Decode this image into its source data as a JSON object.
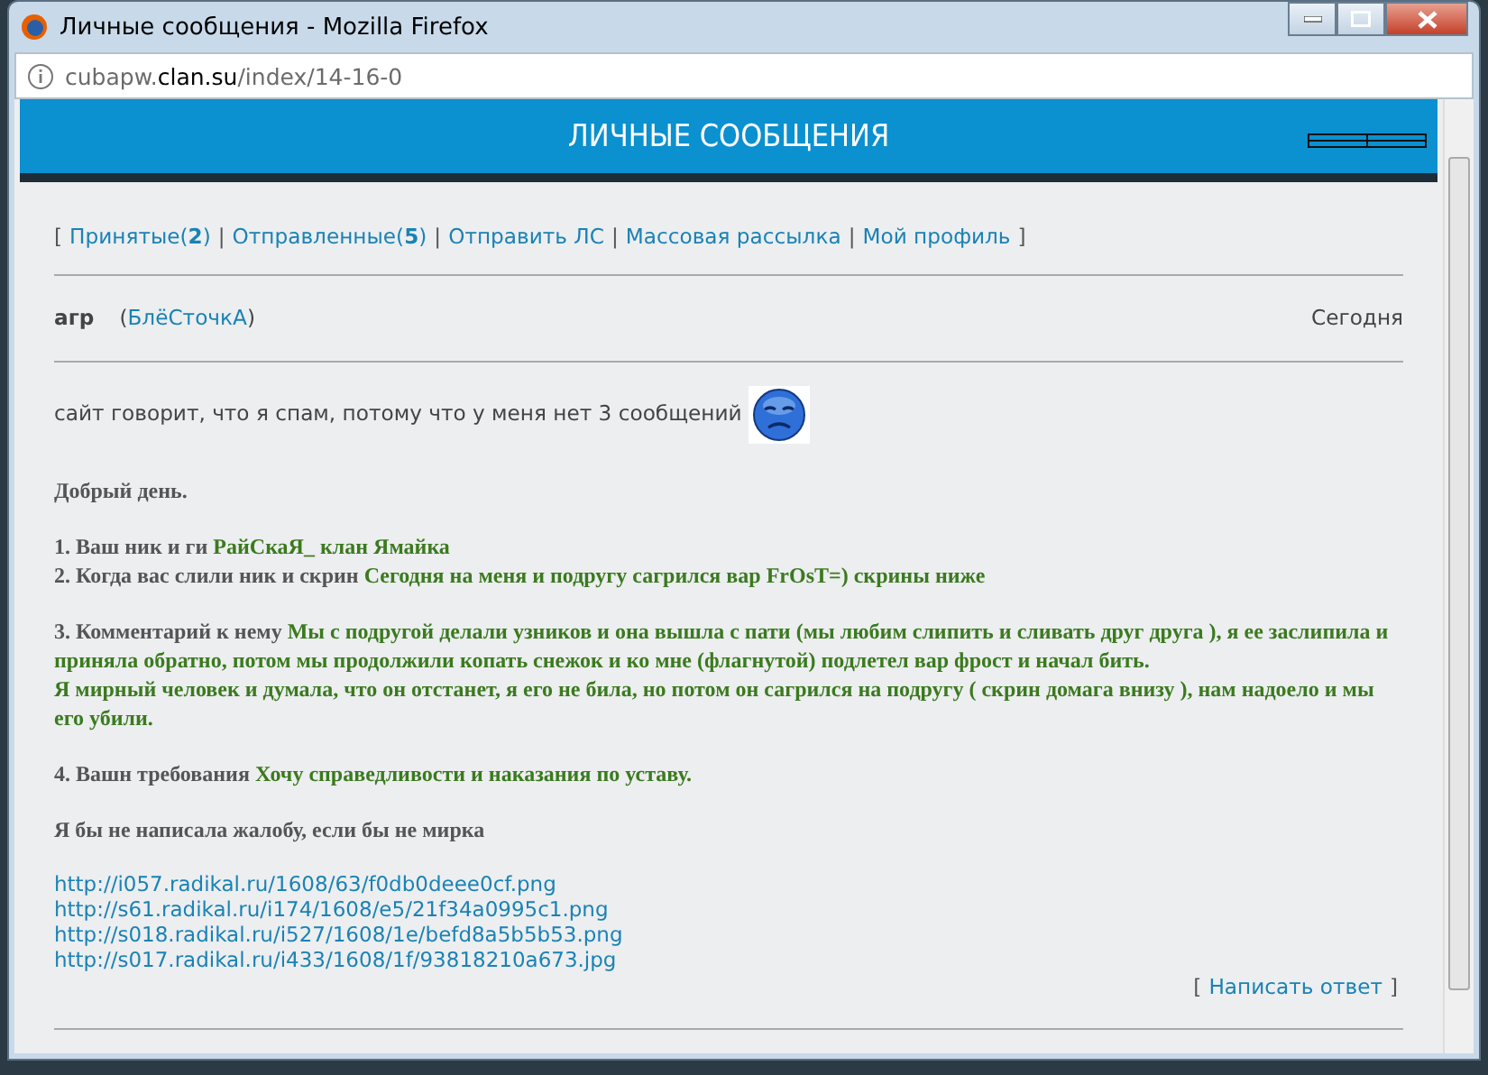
{
  "window": {
    "title": "Личные сообщения - Mozilla Firefox"
  },
  "address_bar": {
    "host_prefix": "cubapw.",
    "domain": "clan.su",
    "path": "/index/14-16-0"
  },
  "page": {
    "header": "ЛИЧНЫЕ СООБЩЕНИЯ",
    "nav": [
      {
        "kind": "bracket",
        "text": "["
      },
      {
        "kind": "link",
        "text": "Принятые(**2**)"
      },
      {
        "kind": "separator",
        "text": "|"
      },
      {
        "kind": "link",
        "text": "Отправленные(**5**)"
      },
      {
        "kind": "separator",
        "text": "|"
      },
      {
        "kind": "link",
        "text": "Отправить ЛС"
      },
      {
        "kind": "separator",
        "text": "|"
      },
      {
        "kind": "link",
        "text": "Массовая рассылка"
      },
      {
        "kind": "separator",
        "text": "|"
      },
      {
        "kind": "link",
        "text": "Мой профиль"
      },
      {
        "kind": "bracket",
        "text": "]"
      }
    ],
    "message": {
      "subject": "агр",
      "open_paren": "(",
      "sender": "БлёСточкА",
      "close_paren": ")",
      "date": "Сегодня",
      "intro": "сайт говорит, что я спам, потому что у меня нет 3 сообщений",
      "paragraphs": [
        [
          {
            "kind": "label",
            "text": "Добрый день."
          }
        ],
        [
          {
            "kind": "label",
            "text": "1. Ваш ник и ги "
          },
          {
            "kind": "answer",
            "text": " РайСкаЯ_  клан Ямайка"
          },
          {
            "kind": "break"
          },
          {
            "kind": "label",
            "text": "2. Когда вас слили ник и скрин "
          },
          {
            "kind": "answer",
            "text": "Сегодня на меня и подругу сагрился вар FrOsT=) скрины ниже"
          }
        ],
        [
          {
            "kind": "label",
            "text": "3. Комментарий к нему "
          },
          {
            "kind": "answer",
            "text": " Мы с подругой делали узников и она вышла с пати (мы любим слипить и сливать друг друга ), я ее заслипила и приняла обратно, потом мы продолжили копать снежок и ко мне (флагнутой) подлетел вар фрост и начал бить."
          },
          {
            "kind": "break"
          },
          {
            "kind": "answer",
            "text": "Я мирный человек и думала, что он отстанет, я его не била, но потом он сагрился на подругу ( скрин домага внизу ), нам надоело и мы его убили."
          }
        ],
        [
          {
            "kind": "label",
            "text": "4. Вашн требования "
          },
          {
            "kind": "answer",
            "text": " Хочу справедливости и наказания по уставу."
          }
        ],
        [
          {
            "kind": "label",
            "text": "Я бы не написала жалобу, если бы не мирка"
          }
        ]
      ],
      "links": [
        "http://i057.radikal.ru/1608/63/f0db0deee0cf.png",
        "http://s61.radikal.ru/i174/1608/e5/21f34a0995c1.png",
        "http://s018.radikal.ru/i527/1608/1e/befd8a5b5b53.png",
        "http://s017.radikal.ru/i433/1608/1f/93818210a673.jpg"
      ],
      "reply": {
        "open": "[",
        "label": "Написать ответ",
        "close": "]"
      }
    }
  }
}
